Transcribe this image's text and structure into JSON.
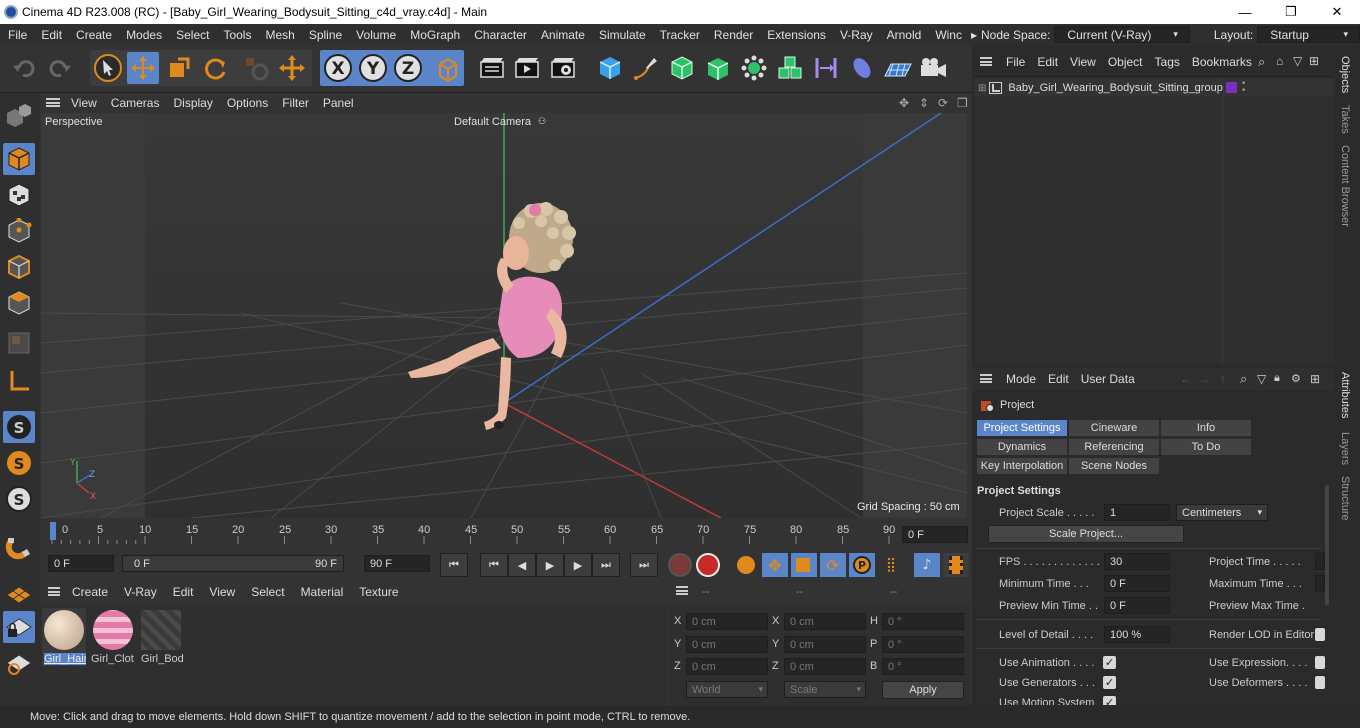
{
  "window": {
    "title": "Cinema 4D R23.008 (RC) - [Baby_Girl_Wearing_Bodysuit_Sitting_c4d_vray.c4d] - Main",
    "controls": [
      "—",
      "❐",
      "✕"
    ]
  },
  "menubar": {
    "items": [
      "File",
      "Edit",
      "Create",
      "Modes",
      "Select",
      "Tools",
      "Mesh",
      "Spline",
      "Volume",
      "MoGraph",
      "Character",
      "Animate",
      "Simulate",
      "Tracker",
      "Render",
      "Extensions",
      "V-Ray",
      "Arnold",
      "Winc"
    ],
    "node_space_label": "Node Space:",
    "node_space_value": "Current (V-Ray)",
    "layout_label": "Layout:",
    "layout_value": "Startup"
  },
  "toolbar": {
    "axis_x": "X",
    "axis_y": "Y",
    "axis_z": "Z"
  },
  "viewport": {
    "menu": [
      "View",
      "Cameras",
      "Display",
      "Options",
      "Filter",
      "Panel"
    ],
    "label": "Perspective",
    "camera": "Default Camera",
    "grid_spacing": "Grid Spacing : 50 cm",
    "axis_y": "Y",
    "axis_z": "Z",
    "axis_x": "X"
  },
  "timeline": {
    "ticks": [
      "0",
      "5",
      "10",
      "15",
      "20",
      "25",
      "30",
      "35",
      "40",
      "45",
      "50",
      "55",
      "60",
      "65",
      "70",
      "75",
      "80",
      "85",
      "90"
    ],
    "current_frame": "0 F"
  },
  "transport": {
    "start_field": "0 F",
    "range_start": "0 F",
    "range_end": "90 F",
    "end_field": "90 F"
  },
  "materials": {
    "menu": [
      "Create",
      "V-Ray",
      "Edit",
      "View",
      "Select",
      "Material",
      "Texture"
    ],
    "items": [
      {
        "name": "Girl_Hair"
      },
      {
        "name": "Girl_Clot"
      },
      {
        "name": "Girl_Bod"
      }
    ]
  },
  "coordinates": {
    "header": [
      "--",
      "--",
      "--"
    ],
    "rows": [
      {
        "a": "X",
        "av": "0 cm",
        "b": "X",
        "bv": "0 cm",
        "c": "H",
        "cv": "0 °"
      },
      {
        "a": "Y",
        "av": "0 cm",
        "b": "Y",
        "bv": "0 cm",
        "c": "P",
        "cv": "0 °"
      },
      {
        "a": "Z",
        "av": "0 cm",
        "b": "Z",
        "bv": "0 cm",
        "c": "B",
        "cv": "0 °"
      }
    ],
    "world": "World",
    "scale": "Scale",
    "apply": "Apply"
  },
  "objects": {
    "menu": [
      "File",
      "Edit",
      "View",
      "Object",
      "Tags",
      "Bookmarks"
    ],
    "item": "Baby_Girl_Wearing_Bodysuit_Sitting_group",
    "tag_color": "#7a2fc0"
  },
  "attributes": {
    "menu": [
      "Mode",
      "Edit",
      "User Data"
    ],
    "title": "Project",
    "tabs": [
      "Project Settings",
      "Cineware",
      "Info",
      "Dynamics",
      "Referencing",
      "To Do",
      "Key Interpolation",
      "Scene Nodes"
    ],
    "section": "Project Settings",
    "project_scale_label": "Project Scale . . . . .",
    "project_scale_value": "1",
    "project_scale_unit": "Centimeters",
    "scale_project_btn": "Scale Project...",
    "fps_label": "FPS . . . . . . . . . . . . .",
    "fps_value": "30",
    "project_time_label": "Project Time . . . . .",
    "min_time_label": "Minimum Time . . .",
    "min_time_value": "0 F",
    "max_time_label": "Maximum Time . . .",
    "prev_min_label": "Preview Min Time . .",
    "prev_min_value": "0 F",
    "prev_max_label": "Preview Max Time .",
    "lod_label": "Level of Detail . . . .",
    "lod_value": "100 %",
    "render_lod_label": "Render LOD in Editor",
    "use_animation_label": "Use Animation . . . .",
    "use_expression_label": "Use Expression. . . .",
    "use_generators_label": "Use Generators . . .",
    "use_deformers_label": "Use Deformers . . . .",
    "use_motion_label": "Use Motion System",
    "check": "✓"
  },
  "side_tabs": {
    "objects": "Objects",
    "takes": "Takes",
    "content_browser": "Content Browser",
    "attributes": "Attributes",
    "layers": "Layers",
    "structure": "Structure"
  },
  "status": "Move: Click and drag to move elements. Hold down SHIFT to quantize movement / add to the selection in point mode, CTRL to remove."
}
